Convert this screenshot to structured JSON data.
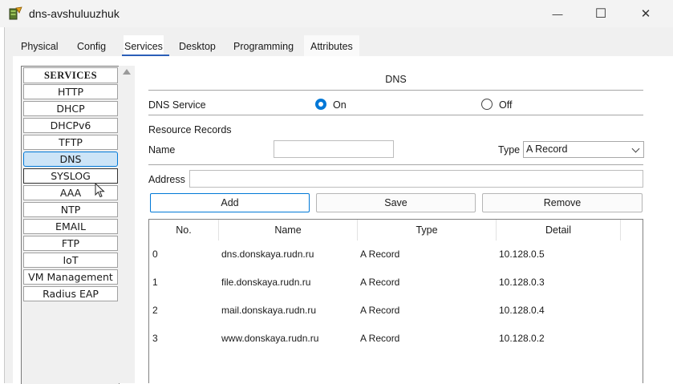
{
  "window": {
    "title": "dns-avshuluuzhuk",
    "minimize_glyph": "—",
    "maximize_glyph": "☐",
    "close_glyph": "✕"
  },
  "tabs": [
    {
      "label": "Physical"
    },
    {
      "label": "Config"
    },
    {
      "label": "Services",
      "selected": true
    },
    {
      "label": "Desktop"
    },
    {
      "label": "Programming"
    },
    {
      "label": "Attributes"
    }
  ],
  "services": {
    "header": "SERVICES",
    "items": [
      {
        "label": "HTTP"
      },
      {
        "label": "DHCP"
      },
      {
        "label": "DHCPv6"
      },
      {
        "label": "TFTP"
      },
      {
        "label": "DNS",
        "selected": true
      },
      {
        "label": "SYSLOG"
      },
      {
        "label": "AAA"
      },
      {
        "label": "NTP"
      },
      {
        "label": "EMAIL"
      },
      {
        "label": "FTP"
      },
      {
        "label": "IoT"
      },
      {
        "label": "VM Management"
      },
      {
        "label": "Radius EAP"
      }
    ]
  },
  "dns": {
    "title": "DNS",
    "service_label": "DNS Service",
    "on_label": "On",
    "off_label": "Off",
    "service_state": "On",
    "resource_records_label": "Resource Records",
    "name_label": "Name",
    "name_value": "",
    "type_label": "Type",
    "type_value": "A Record",
    "address_label": "Address",
    "address_value": "",
    "add_label": "Add",
    "save_label": "Save",
    "remove_label": "Remove",
    "table": {
      "columns": [
        "No.",
        "Name",
        "Type",
        "Detail"
      ],
      "rows": [
        {
          "no": "0",
          "name": "dns.donskaya.rudn.ru",
          "type": "A Record",
          "detail": "10.128.0.5"
        },
        {
          "no": "1",
          "name": "file.donskaya.rudn.ru",
          "type": "A Record",
          "detail": "10.128.0.3"
        },
        {
          "no": "2",
          "name": "mail.donskaya.rudn.ru",
          "type": "A Record",
          "detail": "10.128.0.4"
        },
        {
          "no": "3",
          "name": "www.donskaya.rudn.ru",
          "type": "A Record",
          "detail": "10.128.0.2"
        }
      ]
    }
  },
  "colors": {
    "accent": "#0078d7",
    "tab_underline": "#2b5fb8",
    "selected_bg": "#cce4f7"
  },
  "icons": {
    "app": "packet-tracer-server-icon",
    "cursor": "mouse-pointer-icon"
  }
}
